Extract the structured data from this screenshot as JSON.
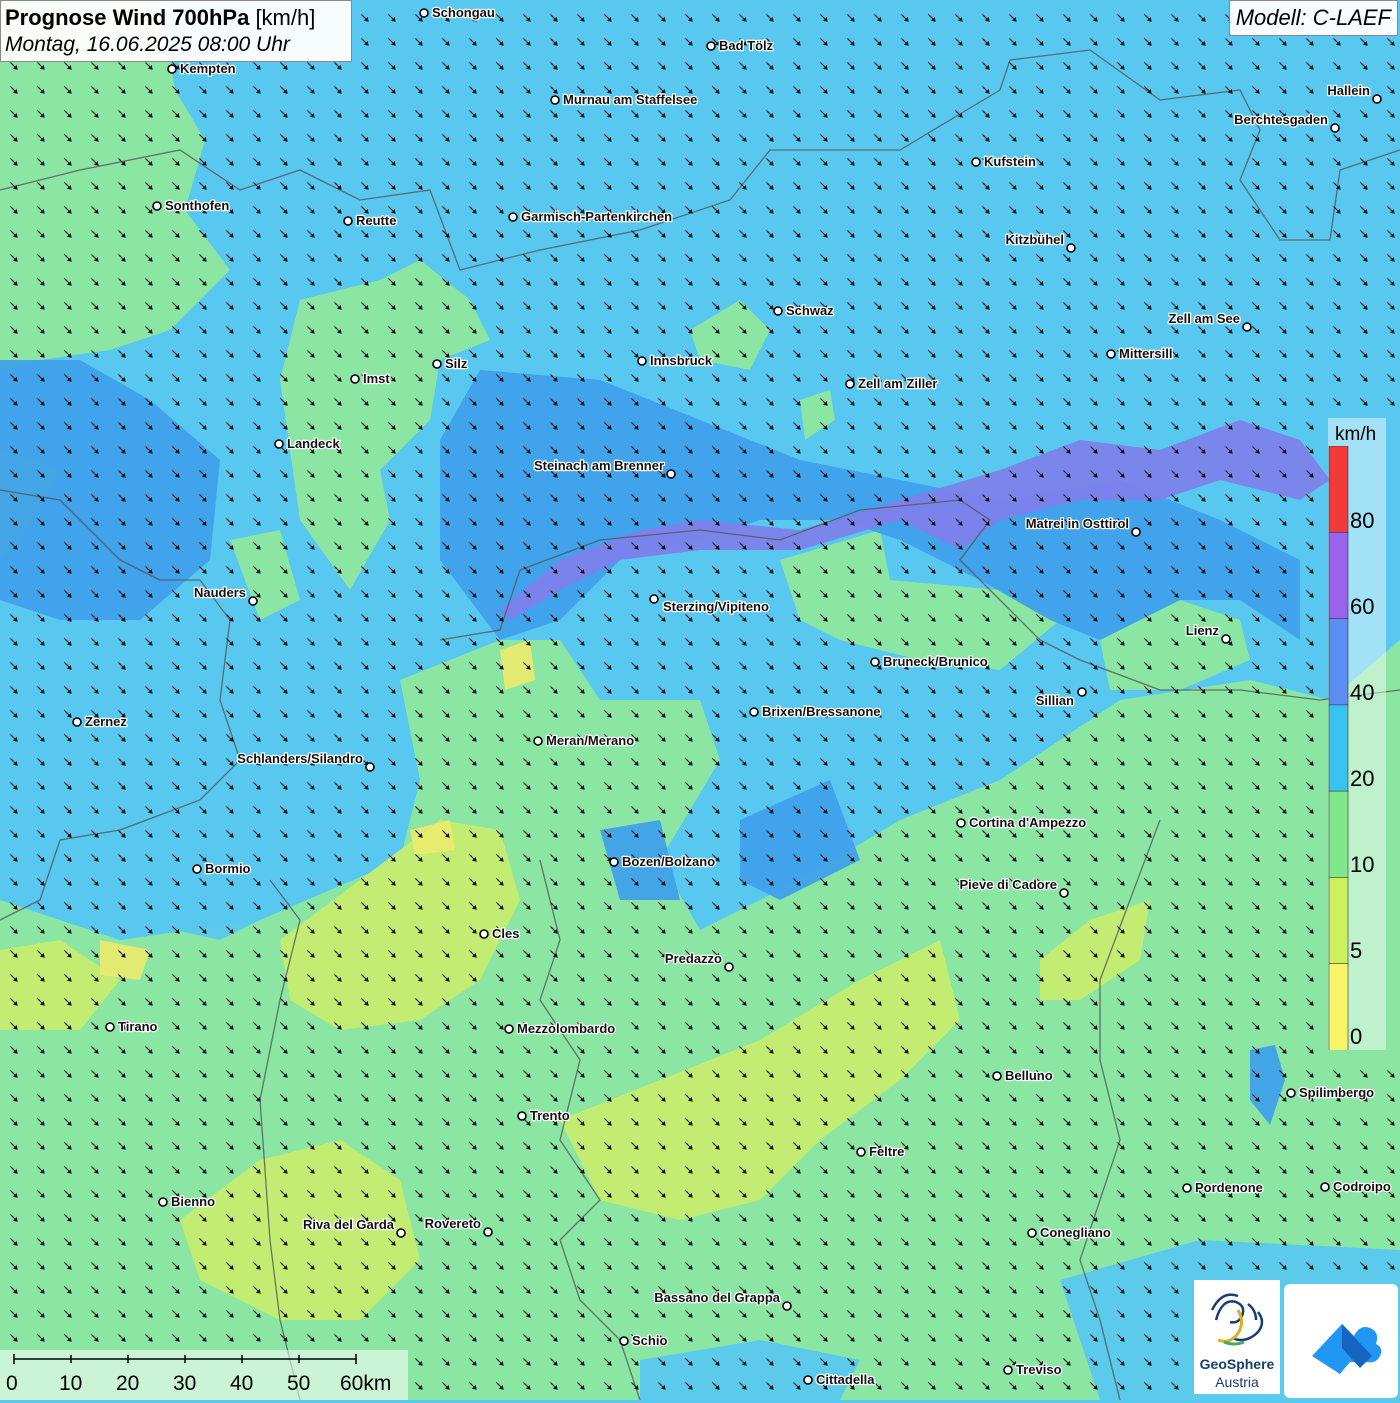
{
  "header": {
    "title": "Prognose Wind 700hPa",
    "unit": "[km/h]",
    "datetime": "Montag, 16.06.2025 08:00 Uhr",
    "model": "Modell: C-LAEF"
  },
  "legend": {
    "unit": "km/h",
    "labels": [
      "80",
      "60",
      "40",
      "20",
      "10",
      "5",
      "0"
    ],
    "colors": [
      "#f23a3a",
      "#9b62ee",
      "#5b8df2",
      "#38c3f0",
      "#7fe88a",
      "#ccf05e",
      "#f8f468"
    ]
  },
  "map_colors": {
    "sky_blue": "#58c8f0",
    "mid_blue": "#3ea0ec",
    "green": "#8fe89c",
    "yellow_green": "#c8ee6e",
    "yellow": "#eaea6e",
    "violet": "#7e80ea",
    "border": "#555555"
  },
  "wind_direction_deg": 135,
  "scale_bar": {
    "labels": [
      "0",
      "10",
      "20",
      "30",
      "40",
      "50",
      "60km"
    ]
  },
  "cities": [
    {
      "name": "Schongau"
    },
    {
      "name": "Bad Tölz"
    },
    {
      "name": "Kempten"
    },
    {
      "name": "Murnau am Staffelsee"
    },
    {
      "name": "Hallein"
    },
    {
      "name": "Berchtesgaden"
    },
    {
      "name": "Kufstein"
    },
    {
      "name": "Sonthofen"
    },
    {
      "name": "Reutte"
    },
    {
      "name": "Garmisch-Partenkirchen"
    },
    {
      "name": "Kitzbühel"
    },
    {
      "name": "Schwaz"
    },
    {
      "name": "Zell am See"
    },
    {
      "name": "Innsbruck"
    },
    {
      "name": "Mittersill"
    },
    {
      "name": "Silz"
    },
    {
      "name": "Imst"
    },
    {
      "name": "Zell am Ziller"
    },
    {
      "name": "Landeck"
    },
    {
      "name": "Steinach am Brenner"
    },
    {
      "name": "Matrei in Osttirol"
    },
    {
      "name": "Nauders"
    },
    {
      "name": "Sterzing/Vipiteno"
    },
    {
      "name": "Lienz"
    },
    {
      "name": "Bruneck/Brunico"
    },
    {
      "name": "Sillian"
    },
    {
      "name": "Brixen/Bressanone"
    },
    {
      "name": "Zernez"
    },
    {
      "name": "Meran/Merano"
    },
    {
      "name": "Schlanders/Silandro"
    },
    {
      "name": "Cortina d'Ampezzo"
    },
    {
      "name": "Bozen/Bolzano"
    },
    {
      "name": "Bormio"
    },
    {
      "name": "Pieve di Cadore"
    },
    {
      "name": "Cles"
    },
    {
      "name": "Predazzo"
    },
    {
      "name": "Tirano"
    },
    {
      "name": "Mezzolombardo"
    },
    {
      "name": "Belluno"
    },
    {
      "name": "Spilimbergo"
    },
    {
      "name": "Trento"
    },
    {
      "name": "Feltre"
    },
    {
      "name": "Pordenone"
    },
    {
      "name": "Codroipo"
    },
    {
      "name": "Bienno"
    },
    {
      "name": "Riva del Garda"
    },
    {
      "name": "Rovereto"
    },
    {
      "name": "Conegliano"
    },
    {
      "name": "Bassano del Grappa"
    },
    {
      "name": "Schio"
    },
    {
      "name": "Treviso"
    },
    {
      "name": "Cittadella"
    }
  ],
  "logos": {
    "geosphere_line1": "GeoSphere",
    "geosphere_line2": "Austria"
  }
}
